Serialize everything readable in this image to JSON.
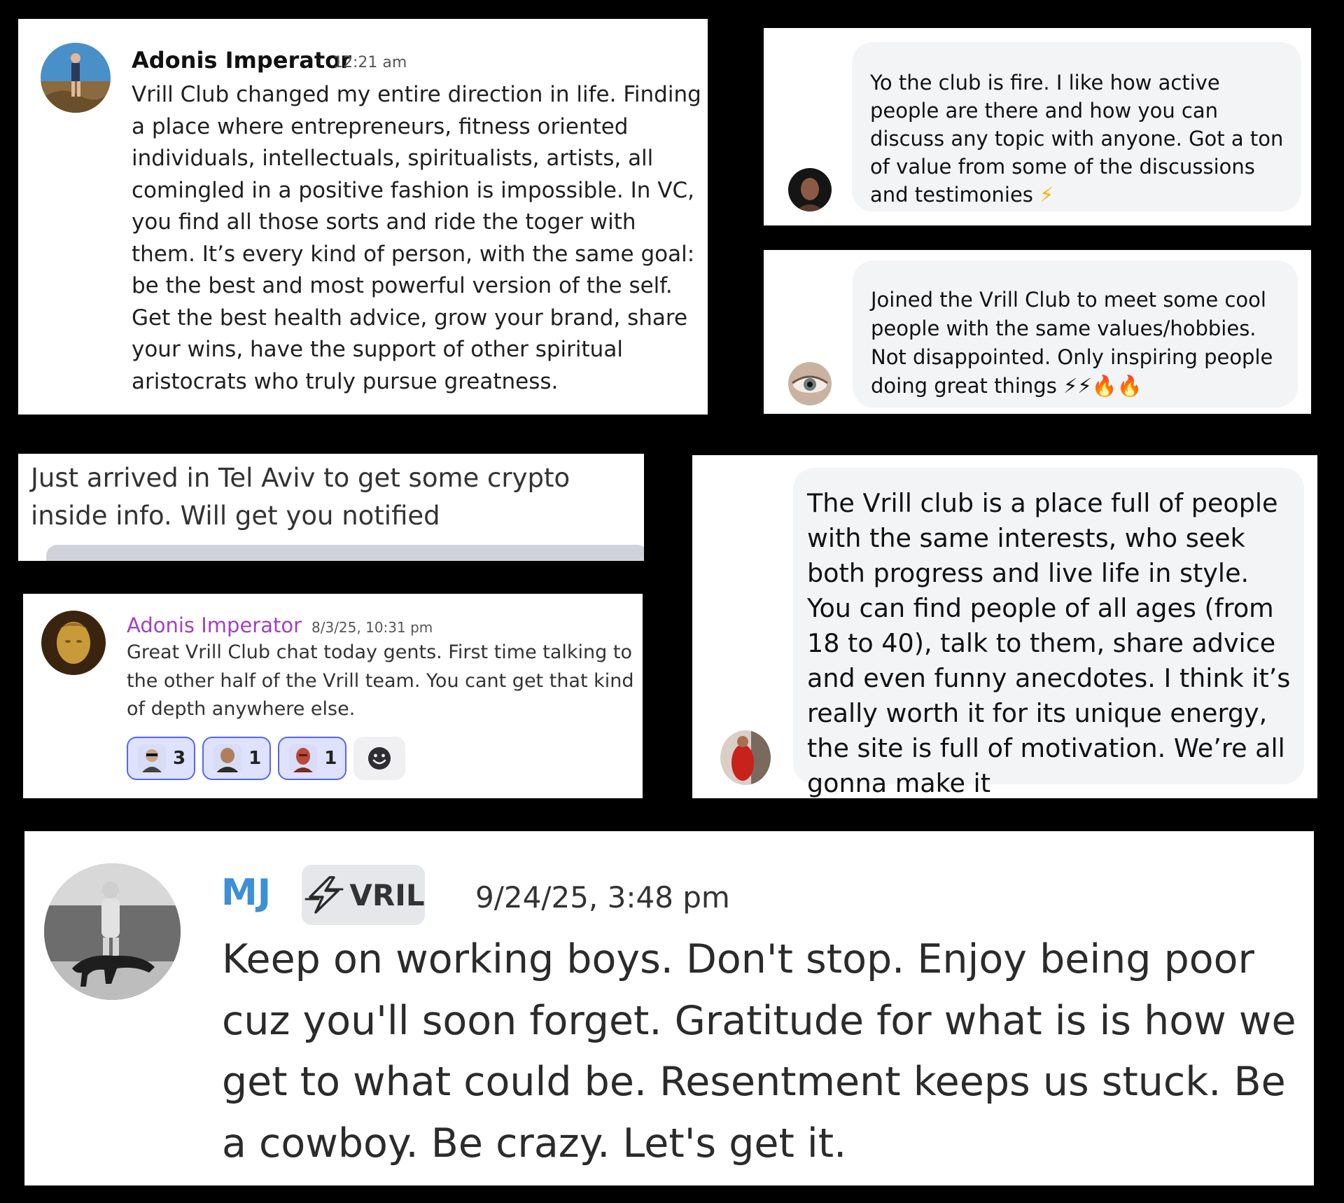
{
  "testimonials": {
    "card1": {
      "author": "Adonis Imperator",
      "timestamp": "12:21 am",
      "avatar_icon": "avatar-man-on-rocks",
      "message": "Vrill Club changed my entire direction in life. Finding a place where entrepreneurs, fitness oriented individuals, intellectuals, spiritualists, artists, all comingled in a positive fashion is impossible. In VC, you find all those sorts and ride the toger with them. It’s every kind of person, with the same goal: be the best and most powerful version of the self. Get the best health advice, grow your brand, share your wins, have the support of other spiritual aristocrats who truly pursue greatness."
    },
    "card2": {
      "message": "Yo the club is fire. I like how active people are there and how you can discuss any topic with anyone. Got a ton of value from some of the discussions and testimonies",
      "emoji": "⚡",
      "avatar_icon": "avatar-dark-portrait"
    },
    "card3": {
      "message": "Joined the Vrill Club to meet some cool people with the same values/hobbies. Not disappointed. Only inspiring people doing great things",
      "emojis": "⚡⚡🔥🔥",
      "avatar_icon": "avatar-eye"
    },
    "card4": {
      "message": "Just arrived in Tel Aviv to get some crypto inside info. Will get you notified"
    },
    "card5": {
      "author": "Adonis Imperator",
      "timestamp": "8/3/25, 10:31 pm",
      "avatar_icon": "avatar-gold-statue",
      "message": "Great Vrill Club chat today gents. First time talking to the other half of the Vrill team. You cant get that kind of depth anywhere else.",
      "reactions": [
        {
          "icon": "reaction-man-sunglasses-icon",
          "count": "3"
        },
        {
          "icon": "reaction-bald-man-icon",
          "count": "1"
        },
        {
          "icon": "reaction-masked-man-icon",
          "count": "1"
        }
      ],
      "add_reaction_icon": "add-reaction-icon"
    },
    "card6": {
      "message": "The Vrill club is a place full of people with the same interests, who seek both progress and live life in style. You can find people of all ages (from 18 to 40), talk to them, share advice and even funny anecdotes. I think it’s really worth it for its unique energy, the site is full of motivation. We’re all gonna make it",
      "avatar_icon": "avatar-red-figure"
    },
    "card7": {
      "author": "MJ",
      "tag": "VRIL",
      "tag_icon": "lightning-bolt-icon",
      "timestamp": "9/24/25, 3:48 pm",
      "avatar_icon": "avatar-man-with-dog",
      "message": "Keep on working boys. Don't stop. Enjoy being poor cuz you'll soon forget. Gratitude for what is is how we get to what could be. Resentment keeps us stuck. Be a cowboy. Be crazy. Let's get it."
    }
  },
  "colors": {
    "background": "#000000",
    "card": "#ffffff",
    "bubble": "#f3f4f6",
    "author_purple": "#a23fc8",
    "author_blue": "#3d8fd6",
    "reaction_border": "#5865f2",
    "reaction_bg": "#dfe2fd"
  }
}
